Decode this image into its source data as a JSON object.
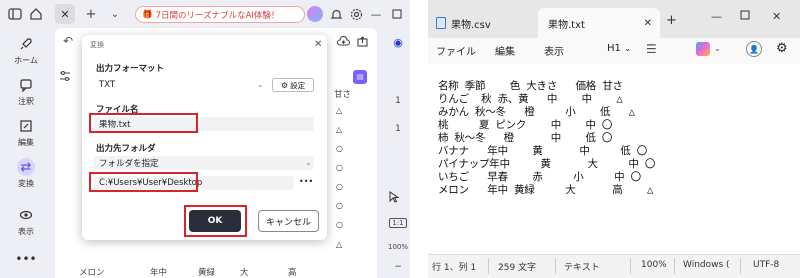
{
  "left_app": {
    "promo_text": "7日間のリーズナブルなAI体験！",
    "sidebar": [
      {
        "label": "ホーム",
        "icon": "rocket-icon"
      },
      {
        "label": "注釈",
        "icon": "comment-icon"
      },
      {
        "label": "編集",
        "icon": "edit-icon"
      },
      {
        "label": "変換",
        "icon": "convert-icon"
      },
      {
        "label": "表示",
        "icon": "eye-icon"
      }
    ],
    "right_bar": {
      "page_top": "1",
      "page_bottom": "1",
      "zoom": "100%",
      "fit_label": "1:1"
    },
    "background_doc": {
      "header_cell": "甘さ",
      "bottom_row": [
        "メロン",
        "年中",
        "黄緑",
        "大",
        "高"
      ]
    },
    "dialog": {
      "title": "変換",
      "format_label": "出力フォーマット",
      "format_value": "TXT",
      "settings_label": "設定",
      "filename_label": "ファイル名",
      "filename_value": "果物.txt",
      "folder_label": "出力先フォルダ",
      "folder_mode": "フォルダを指定",
      "folder_path": "C:¥Users¥User¥Desktop",
      "browse_label": "•••",
      "ok_label": "OK",
      "cancel_label": "キャンセル"
    }
  },
  "notepad": {
    "tabs": [
      {
        "label": "果物.csv",
        "active": false
      },
      {
        "label": "果物.txt",
        "active": true
      }
    ],
    "add_tab": "+",
    "menu": [
      "ファイル",
      "編集",
      "表示"
    ],
    "heading_selector": "H1",
    "lines": [
      "名称 季節    色 大きさ   価格 甘さ",
      "りんご  秋 赤、黄   中    中    △",
      "みかん 秋～冬   橙     小    低   △",
      "桃     夏 ピンク    中    中 〇",
      "柿 秋～冬   橙      中    低 〇",
      "バナナ   年中    黄      中     低 〇",
      "パイナップ年中     黄      大     中 〇",
      "いちご   早春    赤     小     中 〇",
      "メロン   年中 黄緑     大      高    △"
    ],
    "status": {
      "position": "行 1、列 1",
      "chars": "259 文字",
      "mode": "テキスト",
      "zoom": "100%",
      "line_ending": "Windows (",
      "encoding": "UTF-8"
    }
  }
}
